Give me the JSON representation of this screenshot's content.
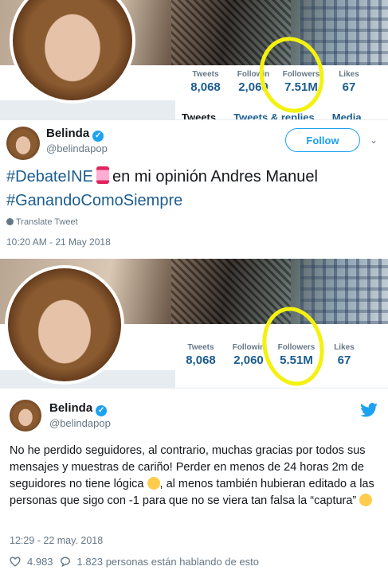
{
  "profile_before": {
    "stats": [
      {
        "label": "Tweets",
        "value": "8,068"
      },
      {
        "label": "Followin",
        "value": "2,060"
      },
      {
        "label": "Followers",
        "value": "7.51M"
      },
      {
        "label": "Likes",
        "value": "67"
      }
    ],
    "tabs": [
      "Tweets",
      "Tweets & replies",
      "Media"
    ]
  },
  "tweet_en": {
    "name": "Belinda",
    "handle": "@belindapop",
    "follow_label": "Follow",
    "hashtag1": "#DebateINE",
    "body": "en mi opinión Andres Manuel",
    "hashtag2": "#GanandoComoSiempre",
    "translate_label": "Translate Tweet",
    "timestamp": "10:20 AM - 21 May 2018"
  },
  "profile_after": {
    "stats": [
      {
        "label": "Tweets",
        "value": "8,068"
      },
      {
        "label": "Followin",
        "value": "2,060"
      },
      {
        "label": "Followers",
        "value": "5.51M"
      },
      {
        "label": "Likes",
        "value": "67"
      }
    ]
  },
  "tweet_es": {
    "name": "Belinda",
    "handle": "@belindapop",
    "text_part1": "No he perdido seguidores, al contrario, muchas gracias por todos sus mensajes y muestras de cariño! Perder en menos de 24 horas 2m de seguidores no tiene lógica",
    "text_part2": ", al menos también hubieran editado a las personas que sigo con -1 para que no se viera tan falsa la “captura”",
    "timestamp": "12:29 - 22 may. 2018",
    "likes": "4.983",
    "talking": "1.823 personas están hablando de esto"
  },
  "colors": {
    "highlight": "#f4f10e",
    "twitter_blue": "#1da1f2",
    "link": "#1b5d8f"
  },
  "icons": [
    "verified-icon",
    "chevron-down-icon",
    "globe-icon",
    "twitter-bird-icon",
    "heart-icon",
    "reply-icon"
  ]
}
